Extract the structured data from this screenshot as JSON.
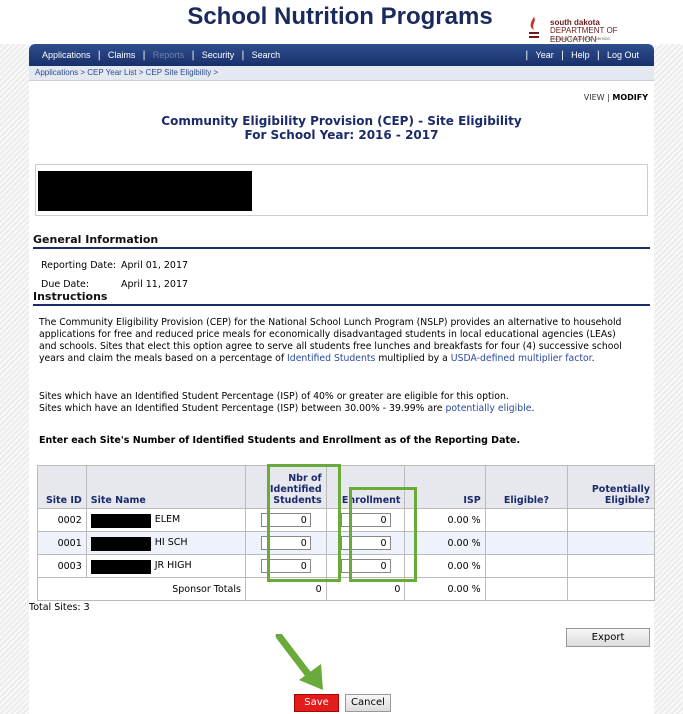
{
  "banner": {
    "title": "School Nutrition Programs",
    "logo_line1": "south dakota",
    "logo_line2": "DEPARTMENT OF EDUCATION",
    "logo_tagline": "Learning. Leadership. Service."
  },
  "nav": {
    "left": [
      "Applications",
      "Claims",
      "Reports",
      "Security",
      "Search"
    ],
    "right": [
      "Year",
      "Help",
      "Log Out"
    ],
    "disabled": [
      "Reports"
    ]
  },
  "breadcrumb": {
    "items": [
      "Applications",
      "CEP Year List",
      "CEP Site Eligibility"
    ],
    "sep": ">"
  },
  "viewmode": {
    "view": "VIEW",
    "sep": "|",
    "modify": "MODIFY"
  },
  "page": {
    "title_line1": "Community Eligibility Provision (CEP) - Site Eligibility",
    "title_line2": "For School Year: 2016 - 2017"
  },
  "general": {
    "heading": "General Information",
    "reporting_label": "Reporting Date:",
    "reporting_value": "April 01, 2017",
    "due_label": "Due Date:",
    "due_value": "April 11, 2017"
  },
  "instructions": {
    "heading": "Instructions",
    "p1_part1": "The Community Eligibility Provision (CEP) for the National School Lunch Program (NSLP) provides an alternative to household applications for free and reduced price meals for economically disadvantaged students in local educational agencies (LEAs) and schools. Sites that elect this option agree to serve all students free lunches and breakfasts for four (4) successive school years and claim the meals based on a percentage of ",
    "p1_link1": "Identified Students",
    "p1_part2": " multiplied by a ",
    "p1_link2": "USDA-defined multiplier factor",
    "p1_part3": ".",
    "p2_line1": "Sites which have an Identified Student Percentage (ISP) of 40% or greater are eligible for this option.",
    "p2_line2a": "Sites which have an Identified Student Percentage (ISP) between 30.00% - 39.99% are ",
    "p2_link": "potentially eligible",
    "p2_line2b": ".",
    "enter_line": "Enter each Site's Number of Identified Students and Enrollment as of the Reporting Date."
  },
  "table": {
    "headers": {
      "site_id": "Site ID",
      "site_name": "Site Name",
      "nbr_line1": "Nbr of",
      "nbr_line2": "Identified",
      "nbr_line3": "Students",
      "enrollment": "Enrollment",
      "isp": "ISP",
      "eligible": "Eligible?",
      "pot_line1": "Potentially",
      "pot_line2": "Eligible?"
    },
    "rows": [
      {
        "site_id": "0002",
        "name_suffix": "ELEM",
        "identified": "0",
        "enrollment": "0",
        "isp": "0.00 %"
      },
      {
        "site_id": "0001",
        "name_suffix": "HI SCH",
        "identified": "0",
        "enrollment": "0",
        "isp": "0.00 %"
      },
      {
        "site_id": "0003",
        "name_suffix": "JR HIGH",
        "identified": "0",
        "enrollment": "0",
        "isp": "0.00 %"
      }
    ],
    "totals": {
      "label": "Sponsor Totals",
      "identified": "0",
      "enrollment": "0",
      "isp": "0.00 %"
    }
  },
  "footer": {
    "total_sites": "Total Sites: 3",
    "export_label": "Export",
    "save_label": "Save",
    "cancel_label": "Cancel"
  },
  "colors": {
    "brand_navy": "#1b2a6b",
    "nav_bg": "#18306b",
    "highlight_green": "#6aaa3a",
    "save_red": "#e21b1b",
    "link_blue": "#2b4b9c"
  }
}
